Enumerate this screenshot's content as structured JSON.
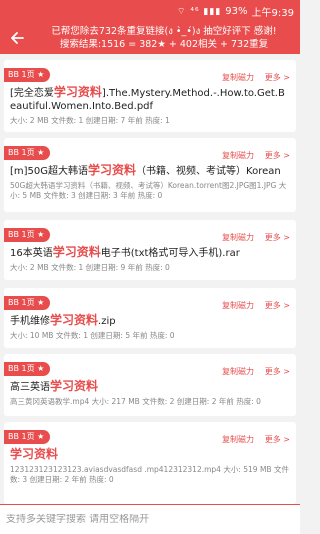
{
  "status_bar": {
    "icons": "⌔ ⁴⁶ ▮▮▮",
    "battery": "93%",
    "time": "上午9:39"
  },
  "header": {
    "line1": "已帮您除去732条重复链接(ง •̀_•́)ง 抽空好评下 感谢!",
    "line2": "搜索结果:1516 = 382★ + 402相关 + 732重复"
  },
  "results": [
    {
      "badge": "BB 1页 ★",
      "title_pre": "[完全恋爱",
      "title_hl": "学习资料",
      "title_post": "].The.Mystery.Method.-.How.to.Get.Beautiful.Women.Into.Bed.pdf",
      "meta": "大小: 2 MB 文件数: 1 创建日期: 7 年前 热度: 1",
      "copy": "复制磁力",
      "more": "更多 >"
    },
    {
      "badge": "BB 1页 ★",
      "title_pre": "[m]50G超大韩语",
      "title_hl": "学习资料",
      "title_post": "（书籍、视频、考试等）Korean",
      "meta": "50G超大韩语学习资料（书籍、视频、考试等）Korean.torrent图2.JPG图1.JPG 大小: 5 MB 文件数: 3 创建日期: 3 年前 热度: 0",
      "copy": "复制磁力",
      "more": "更多 >"
    },
    {
      "badge": "BB 1页 ★",
      "title_pre": "16本英语",
      "title_hl": "学习资料",
      "title_post": "电子书(txt格式可导入手机).rar",
      "meta": "大小: 2 MB 文件数: 1 创建日期: 9 年前 热度: 0",
      "copy": "复制磁力",
      "more": "更多 >"
    },
    {
      "badge": "BB 1页 ★",
      "title_pre": "手机维修",
      "title_hl": "学习资料",
      "title_post": ".zip",
      "meta": "大小: 10 MB 文件数: 1 创建日期: 5 年前 热度: 0",
      "copy": "复制磁力",
      "more": "更多 >"
    },
    {
      "badge": "BB 1页 ★",
      "title_pre": "高三英语",
      "title_hl": "学习资料",
      "title_post": "",
      "meta": "高三黄冈英语教学.mp4 大小: 217 MB 文件数: 2 创建日期: 2 年前 热度: 0",
      "copy": "复制磁力",
      "more": "更多 >"
    },
    {
      "badge": "BB 1页 ★",
      "title_pre": "",
      "title_hl": "学习资料",
      "title_post": "",
      "meta": "123123123123123.aviasdvasdfasd .mp412312312.mp4 大小: 519 MB 文件数: 3 创建日期: 2 年前 热度: 0",
      "copy": "复制磁力",
      "more": "更多 >"
    }
  ],
  "search": {
    "placeholder": "支持多关键字搜索 请用空格隔开"
  }
}
